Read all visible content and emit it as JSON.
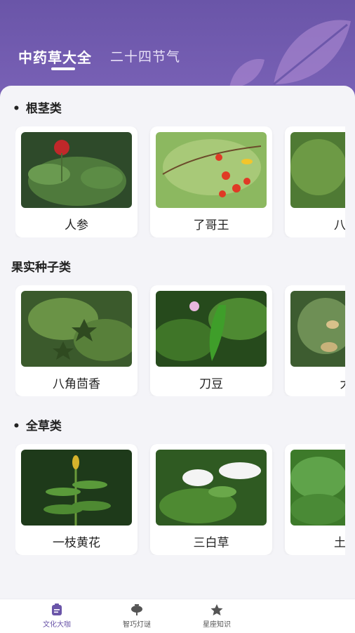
{
  "tabs": [
    {
      "label": "中药草大全",
      "active": true
    },
    {
      "label": "二十四节气",
      "active": false
    }
  ],
  "sections": [
    {
      "title": "根茎类",
      "bullet": "•",
      "items": [
        "人参",
        "了哥王",
        "八角"
      ]
    },
    {
      "title": "果实种子类",
      "bullet": "",
      "items": [
        "八角茴香",
        "刀豆",
        "大"
      ]
    },
    {
      "title": "全草类",
      "bullet": "•",
      "items": [
        "一枝黄花",
        "三白草",
        "土邦"
      ]
    }
  ],
  "bottom_nav": [
    {
      "label": "文化大咖",
      "icon": "clipboard-icon",
      "active": true
    },
    {
      "label": "智巧灯谜",
      "icon": "lantern-icon",
      "active": false
    },
    {
      "label": "星座知识",
      "icon": "star-icon",
      "active": false
    }
  ],
  "colors": {
    "primary": "#6a55a8",
    "background": "#f4f4f8"
  }
}
